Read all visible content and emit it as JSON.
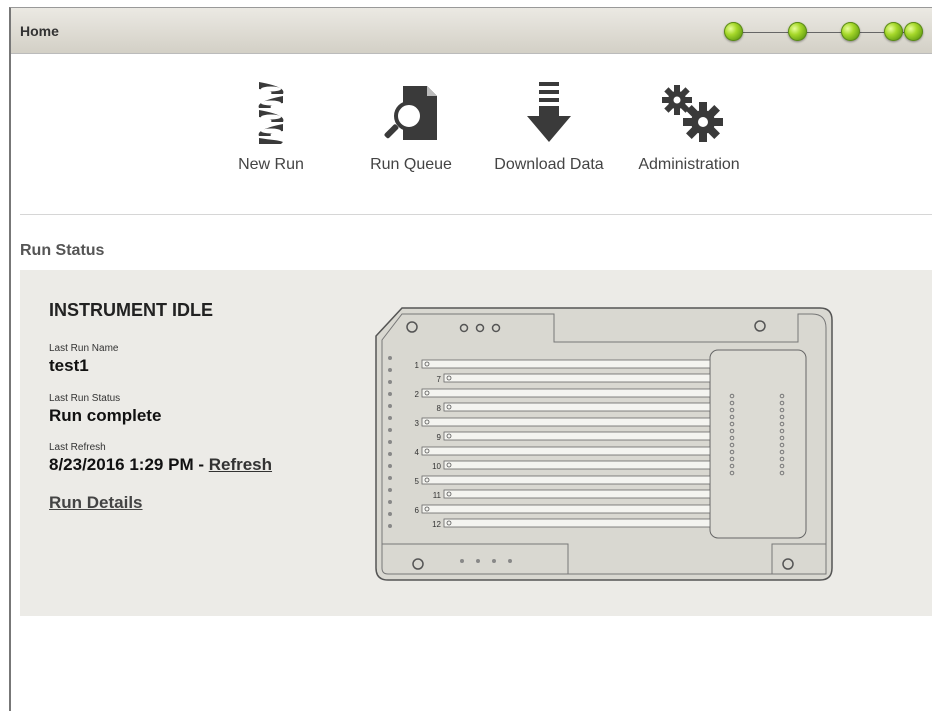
{
  "window": {
    "title": "Home"
  },
  "status_lights": {
    "count": 5,
    "color": "#8fc21e"
  },
  "toolbar": {
    "items": [
      {
        "label": "New Run",
        "icon": "dna-icon"
      },
      {
        "label": "Run Queue",
        "icon": "magnifier-document-icon"
      },
      {
        "label": "Download Data",
        "icon": "download-arrow-icon"
      },
      {
        "label": "Administration",
        "icon": "gears-icon"
      }
    ]
  },
  "run_status": {
    "heading": "Run Status",
    "state": "INSTRUMENT IDLE",
    "last_run_name_label": "Last Run Name",
    "last_run_name": "test1",
    "last_run_status_label": "Last Run Status",
    "last_run_status": "Run complete",
    "last_refresh_label": "Last Refresh",
    "last_refresh_value": "8/23/2016 1:29 PM - ",
    "refresh_link": "Refresh",
    "details_link": "Run Details"
  },
  "chip": {
    "lanes_left": [
      "1",
      "2",
      "3",
      "4",
      "5",
      "6"
    ],
    "lanes_right": [
      "7",
      "8",
      "9",
      "10",
      "11",
      "12"
    ]
  },
  "colors": {
    "panel": "#ecebe7",
    "chip_fill": "#d9d8d1",
    "status_green": "#8fc21e"
  }
}
